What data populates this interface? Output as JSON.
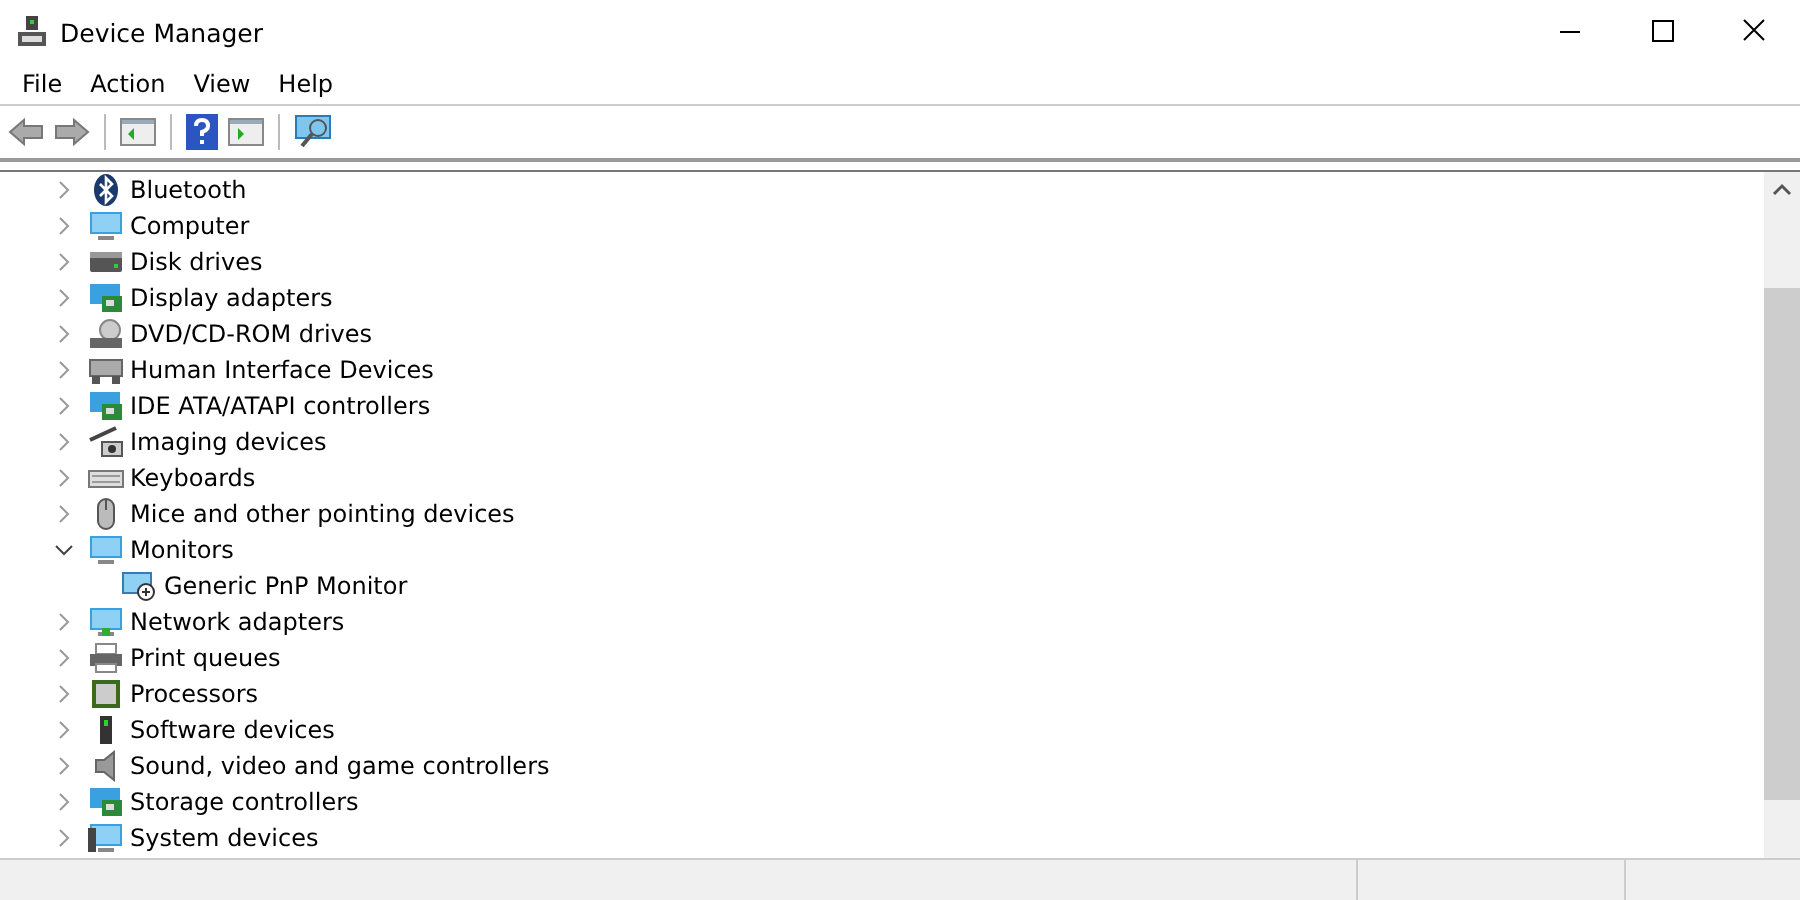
{
  "window": {
    "title": "Device Manager"
  },
  "menu": [
    "File",
    "Action",
    "View",
    "Help"
  ],
  "tree": [
    {
      "label": "Bluetooth",
      "expanded": false
    },
    {
      "label": "Computer",
      "expanded": false
    },
    {
      "label": "Disk drives",
      "expanded": false
    },
    {
      "label": "Display adapters",
      "expanded": false
    },
    {
      "label": "DVD/CD-ROM drives",
      "expanded": false
    },
    {
      "label": "Human Interface Devices",
      "expanded": false
    },
    {
      "label": "IDE ATA/ATAPI controllers",
      "expanded": false
    },
    {
      "label": "Imaging devices",
      "expanded": false
    },
    {
      "label": "Keyboards",
      "expanded": false
    },
    {
      "label": "Mice and other pointing devices",
      "expanded": false
    },
    {
      "label": "Monitors",
      "expanded": true,
      "children": [
        {
          "label": "Generic PnP Monitor"
        }
      ]
    },
    {
      "label": "Network adapters",
      "expanded": false
    },
    {
      "label": "Print queues",
      "expanded": false
    },
    {
      "label": "Processors",
      "expanded": false
    },
    {
      "label": "Software devices",
      "expanded": false
    },
    {
      "label": "Sound, video and game controllers",
      "expanded": false
    },
    {
      "label": "Storage controllers",
      "expanded": false
    },
    {
      "label": "System devices",
      "expanded": false
    }
  ]
}
